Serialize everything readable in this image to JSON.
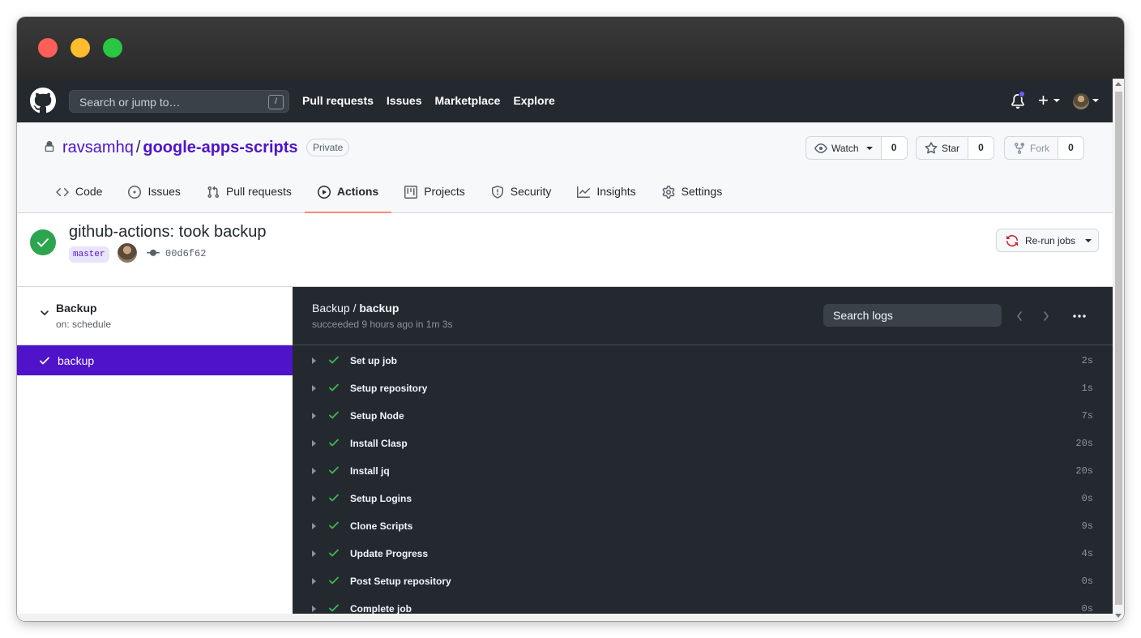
{
  "header": {
    "search_placeholder": "Search or jump to…",
    "search_shortcut": "/",
    "nav": [
      "Pull requests",
      "Issues",
      "Marketplace",
      "Explore"
    ],
    "plus": "+"
  },
  "repo": {
    "owner": "ravsamhq",
    "separator": "/",
    "name": "google-apps-scripts",
    "visibility": "Private",
    "watch": {
      "label": "Watch",
      "count": "0"
    },
    "star": {
      "label": "Star",
      "count": "0"
    },
    "fork": {
      "label": "Fork",
      "count": "0"
    },
    "tabs": [
      {
        "label": "Code",
        "icon": "code-icon"
      },
      {
        "label": "Issues",
        "icon": "issue-icon"
      },
      {
        "label": "Pull requests",
        "icon": "pull-request-icon"
      },
      {
        "label": "Actions",
        "icon": "play-icon",
        "active": true
      },
      {
        "label": "Projects",
        "icon": "project-icon"
      },
      {
        "label": "Security",
        "icon": "shield-icon"
      },
      {
        "label": "Insights",
        "icon": "graph-icon"
      },
      {
        "label": "Settings",
        "icon": "gear-icon"
      }
    ]
  },
  "run": {
    "title": "github-actions: took backup",
    "branch": "master",
    "sha": "00d6f62",
    "rerun_label": "Re-run jobs"
  },
  "workflow": {
    "name": "Backup",
    "trigger": "on: schedule",
    "job": "backup"
  },
  "log": {
    "workflow": "Backup",
    "sep": " / ",
    "job": "backup",
    "status": "succeeded 9 hours ago in 1m 3s",
    "search_placeholder": "Search logs",
    "steps": [
      {
        "name": "Set up job",
        "duration": "2s"
      },
      {
        "name": "Setup repository",
        "duration": "1s"
      },
      {
        "name": "Setup Node",
        "duration": "7s"
      },
      {
        "name": "Install Clasp",
        "duration": "20s"
      },
      {
        "name": "Install jq",
        "duration": "20s"
      },
      {
        "name": "Setup Logins",
        "duration": "0s"
      },
      {
        "name": "Clone Scripts",
        "duration": "9s"
      },
      {
        "name": "Update Progress",
        "duration": "4s"
      },
      {
        "name": "Post Setup repository",
        "duration": "0s"
      },
      {
        "name": "Complete job",
        "duration": "0s"
      }
    ]
  },
  "colors": {
    "accent": "#4f13c9",
    "success": "#2da44e",
    "header_bg": "#24292f",
    "tab_underline": "#fd8c73"
  }
}
